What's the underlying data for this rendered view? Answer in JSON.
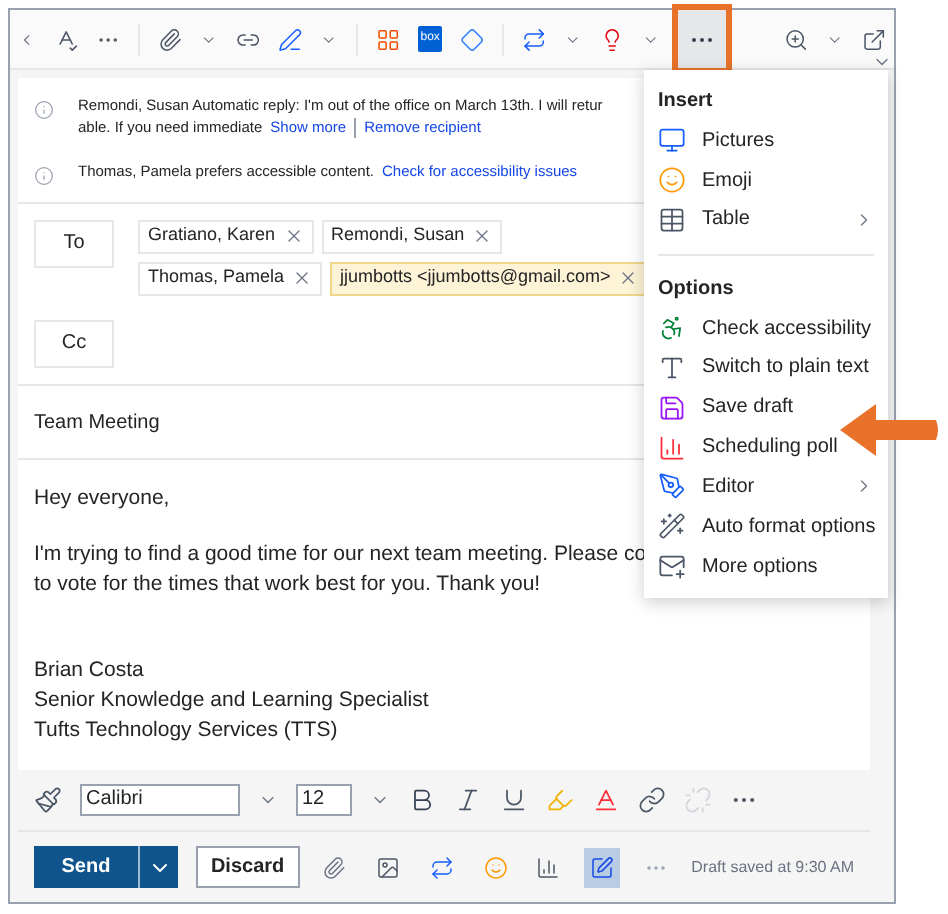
{
  "toolbar": {
    "box_logo": "box",
    "more_selected": true
  },
  "notices": [
    {
      "text": "Remondi, Susan Automatic reply: I'm out of the office on March 13th. I will retur",
      "text2": "able. If you need immediate",
      "links": [
        "Show more",
        "Remove recipient"
      ]
    },
    {
      "text": "Thomas, Pamela prefers accessible content.",
      "links": [
        "Check for accessibility issues"
      ]
    }
  ],
  "to": {
    "label": "To",
    "recipients": [
      {
        "name": "Gratiano, Karen",
        "external": false
      },
      {
        "name": "Remondi, Susan",
        "external": false
      },
      {
        "name": "Thomas, Pamela",
        "external": false
      },
      {
        "name": "jjumbotts <jjumbotts@gmail.com>",
        "external": true
      }
    ]
  },
  "cc": {
    "label": "Cc"
  },
  "subject": "Team Meeting",
  "body": {
    "greeting": "Hey everyone,",
    "message": [
      "I'm trying to find a good time for our next team meeting. Please co",
      "to vote for the times that work best for you. Thank you!"
    ],
    "signature": [
      "Brian Costa",
      "Senior Knowledge and Learning Specialist",
      "Tufts Technology Services (TTS)"
    ]
  },
  "format_bar": {
    "font": "Calibri",
    "size": "12"
  },
  "actions": {
    "send": "Send",
    "discard": "Discard",
    "status": "Draft saved at 9:30 AM",
    "tools": [
      {
        "selected": false
      },
      {
        "selected": false
      },
      {
        "selected": false
      },
      {
        "selected": false
      },
      {
        "selected": false
      },
      {
        "selected": true
      },
      {
        "selected": false
      }
    ]
  },
  "menu": [
    {
      "kind": "header",
      "label": "Insert"
    },
    {
      "kind": "item",
      "label": "Pictures",
      "submenu": false
    },
    {
      "kind": "item",
      "label": "Emoji",
      "submenu": false
    },
    {
      "kind": "item",
      "label": "Table",
      "submenu": true
    },
    {
      "kind": "divider"
    },
    {
      "kind": "header",
      "label": "Options"
    },
    {
      "kind": "item",
      "label": "Check accessibility",
      "submenu": false
    },
    {
      "kind": "item",
      "label": "Switch to plain text",
      "submenu": false
    },
    {
      "kind": "item",
      "label": "Save draft",
      "submenu": false
    },
    {
      "kind": "item",
      "label": "Scheduling poll",
      "submenu": false
    },
    {
      "kind": "item",
      "label": "Editor",
      "submenu": true
    },
    {
      "kind": "item",
      "label": "Auto format options",
      "submenu": false
    },
    {
      "kind": "item",
      "label": "More options",
      "submenu": false
    }
  ]
}
